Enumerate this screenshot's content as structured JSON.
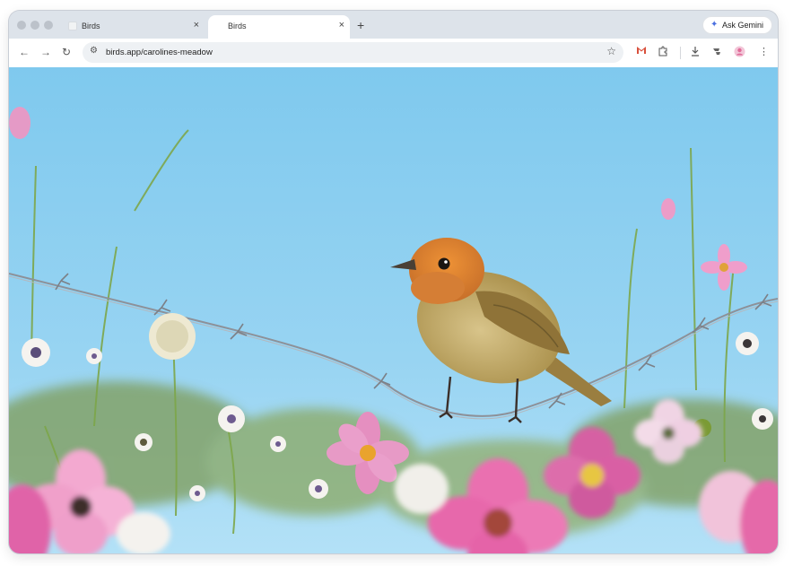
{
  "browser": {
    "tabs": [
      {
        "title": "Birds"
      },
      {
        "title": "Birds"
      }
    ],
    "new_tab": "+",
    "tab_close": "×",
    "ask_gemini": "Ask Gemini",
    "url": "birds.app/carolines-meadow"
  },
  "icons": {
    "back": "back-arrow-icon",
    "forward": "forward-arrow-icon",
    "reload": "reload-icon",
    "site_info": "tune-icon",
    "bookmark": "star-icon",
    "extension_1": "gmail-icon",
    "extensions": "puzzle-icon",
    "download": "download-icon",
    "extension_2": "extension-icon",
    "profile": "profile-icon",
    "menu": "kebab-menu-icon",
    "gemini": "gemini-sparkle-icon"
  },
  "colors": {
    "sky": "#7fc9ee",
    "sky_light": "#b3e1f7",
    "bird_head": "#e2832c",
    "bird_body": "#b99a4f",
    "bird_belly": "#d8c48a",
    "flower_pink": "#e67fb4",
    "flower_white": "#f3f1ef",
    "foliage": "#6e8f3a"
  },
  "page": {
    "image_subject": "bird-perched-on-barbed-wire"
  }
}
